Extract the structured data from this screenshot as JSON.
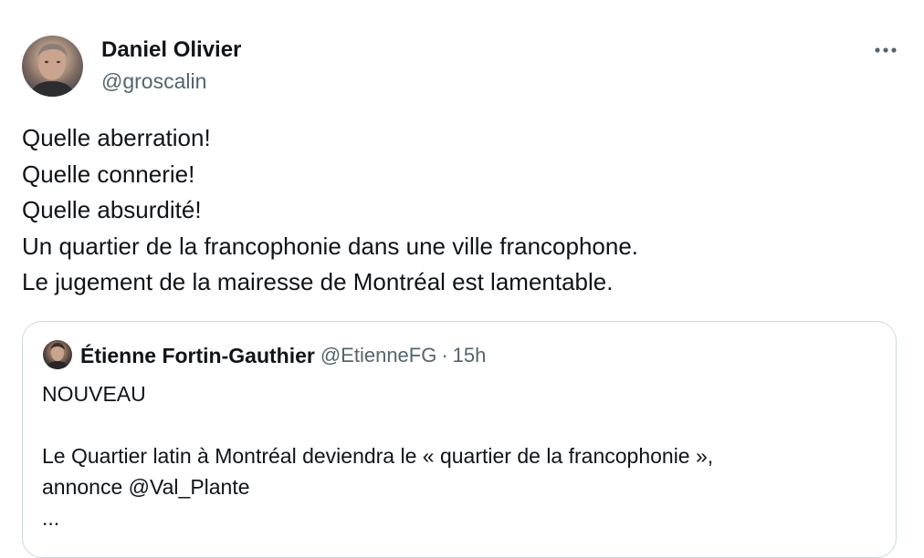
{
  "author": {
    "display_name": "Daniel Olivier",
    "handle": "@groscalin"
  },
  "more_icon": "more-horizontal-icon",
  "tweet": {
    "lines": [
      "Quelle aberration!",
      "Quelle connerie!",
      "Quelle absurdité!",
      "Un quartier de la francophonie dans une ville francophone.",
      "Le jugement de la mairesse de Montréal est lamentable."
    ]
  },
  "quoted": {
    "display_name": "Étienne Fortin-Gauthier",
    "handle": "@EtienneFG",
    "separator": "·",
    "time": "15h",
    "lines": [
      "NOUVEAU",
      "",
      "Le Quartier latin à Montréal deviendra le « quartier de la francophonie »,",
      "annonce @Val_Plante",
      "..."
    ]
  }
}
